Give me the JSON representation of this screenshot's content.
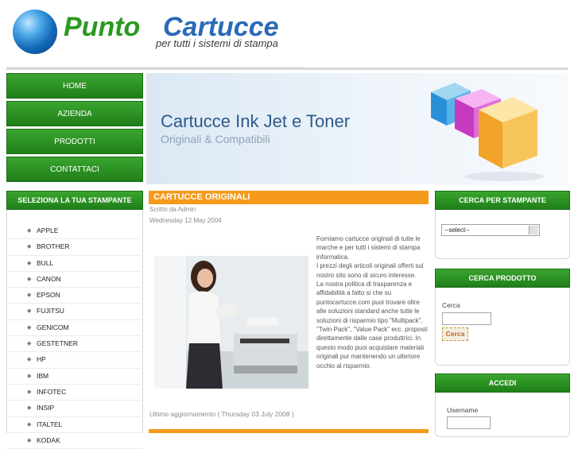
{
  "logo": {
    "brand_part1": "Punto",
    "brand_part2": "Cartucce",
    "tagline": "per tutti i sistemi di stampa"
  },
  "nav": {
    "items": [
      "HOME",
      "AZIENDA",
      "PRODOTTI",
      "CONTATTACI"
    ]
  },
  "banner": {
    "title": "Cartucce Ink Jet e Toner",
    "subtitle": "Originali & Compatibili"
  },
  "left_sidebar": {
    "title": "SELEZIONA LA TUA STAMPANTE",
    "brands": [
      "APPLE",
      "BROTHER",
      "BULL",
      "CANON",
      "EPSON",
      "FUJITSU",
      "GENICOM",
      "GESTETNER",
      "HP",
      "IBM",
      "INFOTEC",
      "INSIP",
      "ITALTEL",
      "KODAK"
    ]
  },
  "article": {
    "title": "CARTUCCE ORIGINALI",
    "author": "Scritto da Admin",
    "date": "Wednesday 12 May 2004",
    "paragraphs": [
      "Forniamo cartucce originali di tutte le marche e per tutti i sistemi di stampa informatica.",
      "I prezzi degli articoli originali offerti sul nostro sito sono di sicuro interesse.",
      "La nostra politica di trasparenza e affidabilità a fatto si che su puntocartucce.com puoi trovare oltre alle soluzioni standard anche tutte le soluzioni di risparmio tipo \"Multipack\", \"Twin Pack\", \"Value Pack\" ecc. proposti direttamente dalle case produttrici. In questo modo puoi acquistare materiali originali pur mantenendo un ulteriore occhio al risparmio."
    ],
    "updated": "Ultimo aggiornamento ( Thursday 03 July 2008 )"
  },
  "right_sidebar": {
    "printer_search": {
      "title": "CERCA PER STAMPANTE",
      "select_value": "--select--"
    },
    "product_search": {
      "title": "CERCA PRODOTTO",
      "label": "Cerca",
      "button": "Cerca"
    },
    "login": {
      "title": "ACCEDI",
      "username_label": "Username"
    }
  },
  "colors": {
    "green": "#2a9a1e",
    "blue": "#2a6ab8",
    "orange": "#f59a1a"
  }
}
